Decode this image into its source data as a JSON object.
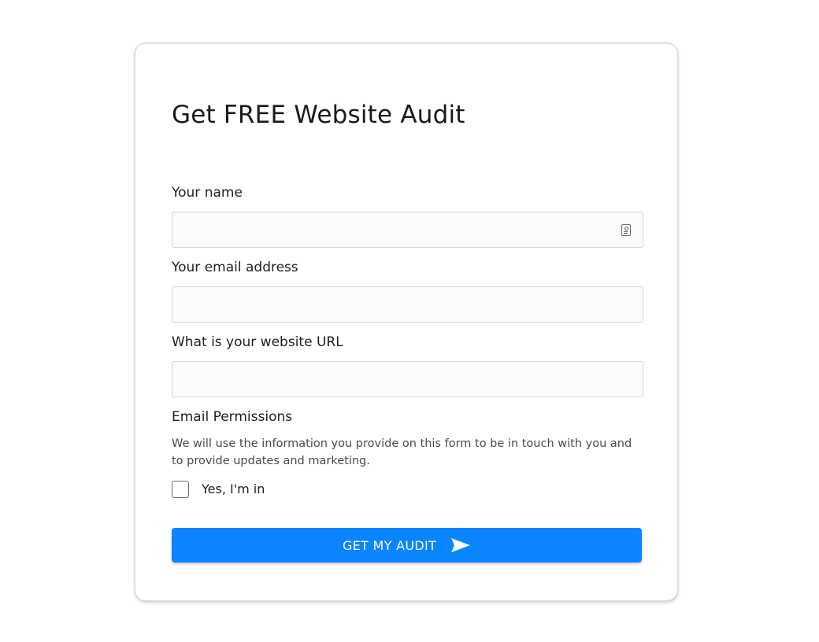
{
  "form": {
    "title": "Get FREE Website Audit",
    "fields": [
      {
        "label": "Your name",
        "value": "",
        "placeholder": ""
      },
      {
        "label": "Your email address",
        "value": "",
        "placeholder": ""
      },
      {
        "label": "What is your website URL",
        "value": "",
        "placeholder": ""
      }
    ],
    "permissions": {
      "heading": "Email Permissions",
      "text": "We will use the information you provide on this form to be in touch with you and to provide updates and marketing.",
      "checkbox_label": "Yes, I'm in",
      "checked": false
    },
    "submit": {
      "label": "GET MY AUDIT",
      "icon": "send-icon",
      "color": "#0a84ff"
    },
    "name_field_icon": "contact-card-icon"
  }
}
